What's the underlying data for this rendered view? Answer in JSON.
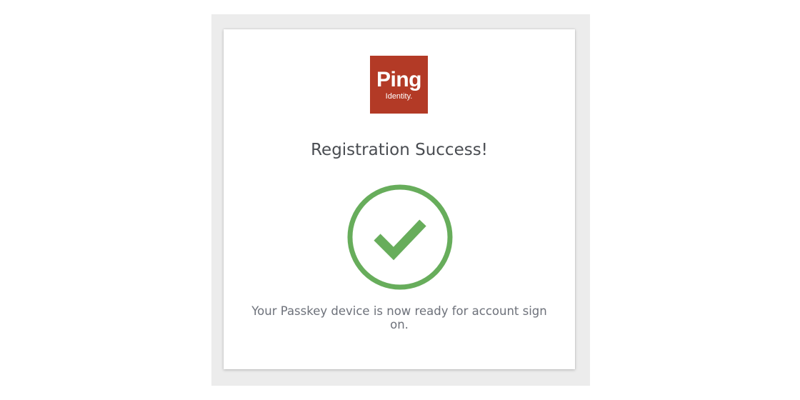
{
  "logo": {
    "word": "Ping",
    "sub": "Identity.",
    "color": "#b33a26"
  },
  "title": "Registration Success!",
  "status_icon": {
    "name": "checkmark-circle-icon",
    "color": "#67ad5b"
  },
  "message": "Your Passkey device is now ready for account sign on."
}
